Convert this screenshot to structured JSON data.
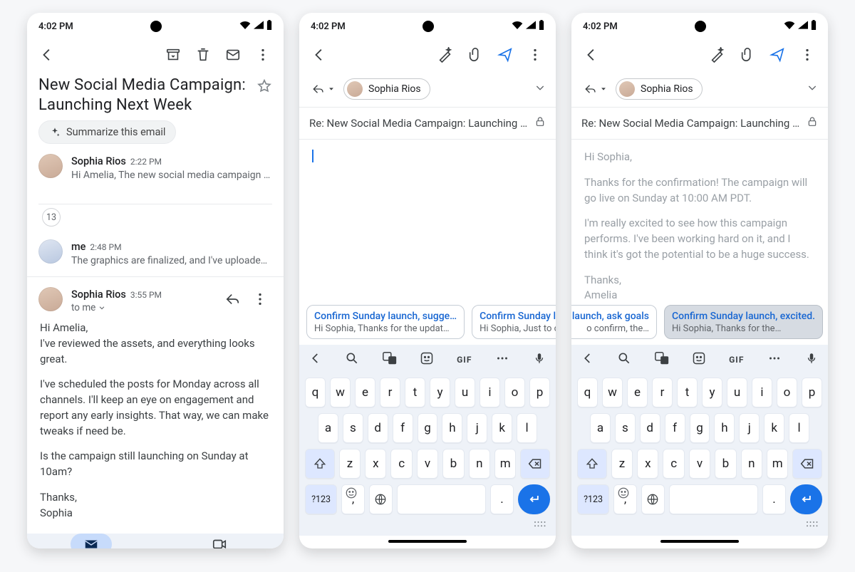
{
  "status": {
    "time": "4:02 PM"
  },
  "screen1": {
    "subject": "New Social Media Campaign: Launching Next Week",
    "summarize_label": "Summarize this email",
    "collapsed_count": "13",
    "msg1": {
      "from": "Sophia Rios",
      "time": "2:22 PM",
      "snippet": "Hi Amelia, The new social media campaign for ou…"
    },
    "msg2": {
      "from": "me",
      "time": "2:48 PM",
      "snippet": "The graphics are finalized, and I've uploaded the…"
    },
    "msg3": {
      "from": "Sophia Rios",
      "time": "3:55 PM",
      "to_line": "to me",
      "body_line1": "Hi Amelia,",
      "body_line2": "I've reviewed the assets, and everything looks great.",
      "body_para2": "I've scheduled the posts for Monday across all channels. I'll keep an eye on engagement and report any early insights. That way, we can make tweaks if need be.",
      "body_para3": "Is the campaign still launching on Sunday at 10am?",
      "signoff1": "Thanks,",
      "signoff2": "Sophia"
    }
  },
  "compose": {
    "contact": "Sophia Rios",
    "subject": "Re: New Social Media Campaign: Launching N…"
  },
  "screen2": {
    "sugg1": {
      "title": "Confirm Sunday launch, sugge…",
      "sub": "Hi Sophia, Thanks for the updat…"
    },
    "sugg2": {
      "title": "Confirm Sunday la",
      "sub": "Hi Sophia, Just to c"
    }
  },
  "screen3": {
    "draft": {
      "l1": "Hi Sophia,",
      "p1": "Thanks for the confirmation! The campaign will go live on Sunday at 10:00 AM PDT.",
      "p2": "I'm really excited to see how this campaign performs. I've been working hard on it, and I think it's got the potential to be a huge success.",
      "s1": "Thanks,",
      "s2": "Amelia"
    },
    "sugg1": {
      "title": "y launch, ask goals",
      "sub": "o confirm, the…"
    },
    "sugg2": {
      "title": "Confirm Sunday launch, excited.",
      "sub": "Hi Sophia, Thanks for the…"
    }
  },
  "keyboard": {
    "row1": [
      "q",
      "w",
      "e",
      "r",
      "t",
      "y",
      "u",
      "i",
      "o",
      "p"
    ],
    "row2": [
      "a",
      "s",
      "d",
      "f",
      "g",
      "h",
      "j",
      "k",
      "l"
    ],
    "row3": [
      "z",
      "x",
      "c",
      "v",
      "b",
      "n",
      "m"
    ],
    "symbols_label": "?123",
    "gif_label": "GIF"
  }
}
